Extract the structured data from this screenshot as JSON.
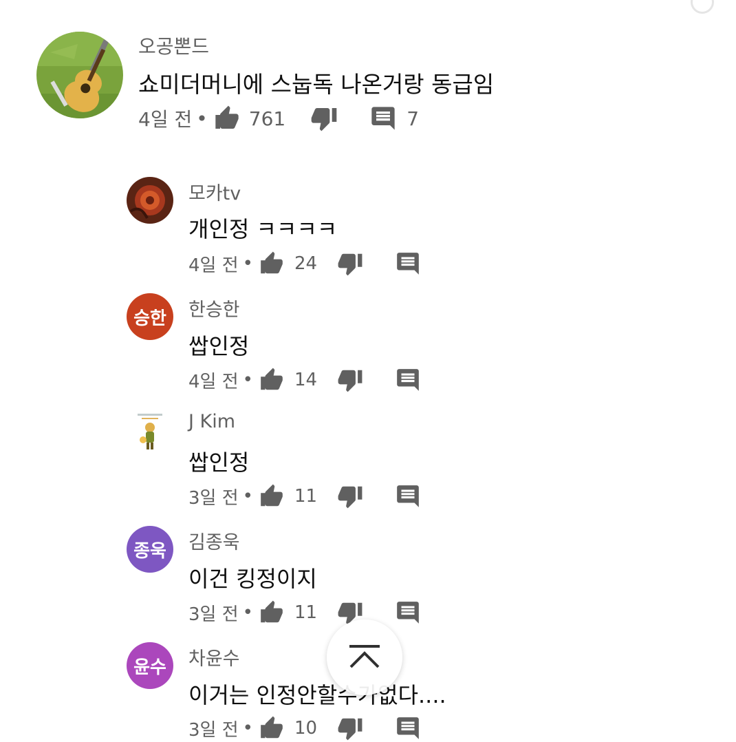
{
  "top_comment": {
    "author": "오공뽄드",
    "text": "쇼미더머니에 스눕독 나온거랑 동급임",
    "time": "4일 전",
    "separator": "•",
    "likes": "761",
    "replies": "7",
    "avatar_icon": "guitar-on-grass-photo"
  },
  "replies": [
    {
      "author": "모카tv",
      "text": "개인정 ㅋㅋㅋㅋ",
      "time": "4일 전",
      "likes": "24",
      "avatar_icon": "red-flower-photo"
    },
    {
      "author": "한승한",
      "text": "쌉인정",
      "time": "4일 전",
      "likes": "14",
      "avatar_text": "승한",
      "avatar_color": "#c8401e"
    },
    {
      "author": "J Kim",
      "text": "쌉인정",
      "time": "3일 전",
      "likes": "11",
      "avatar_icon": "cartoon-character"
    },
    {
      "author": "김종욱",
      "text": "이건 킹정이지",
      "time": "3일 전",
      "likes": "11",
      "avatar_text": "종욱",
      "avatar_color": "#7e57c2"
    },
    {
      "author": "차윤수",
      "text": "이거는 인정안할수가없다....",
      "time": "3일 전",
      "likes": "10",
      "avatar_text": "윤수",
      "avatar_color": "#ab47bc"
    }
  ],
  "ui": {
    "separator": "•",
    "like_icon": "thumbs-up-icon",
    "dislike_icon": "thumbs-down-icon",
    "reply_icon": "comment-icon",
    "scroll_icon": "chevron-up-icon",
    "icon_color": "#606060"
  }
}
